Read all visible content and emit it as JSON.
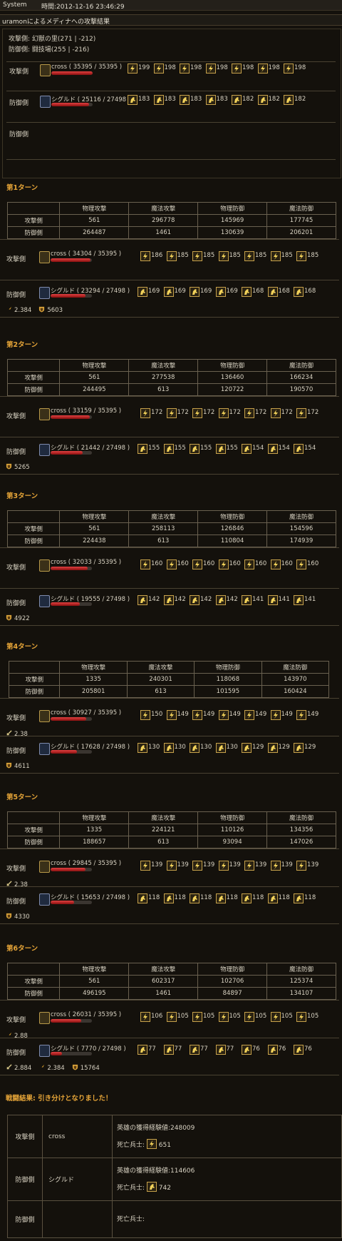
{
  "topbar": {
    "system": "System",
    "time": "時間:2012-12-16 23:46:29"
  },
  "title": "uramonによるメディナへの攻撃結果",
  "summary": {
    "attacker_line": "攻撃側: 幻獣の里(271 | -212)",
    "defender_line": "防御側: 闘技場(255 | -216)",
    "rows": [
      {
        "label": "攻撃側",
        "name": "cross ( 35395 / 35395 )",
        "hp": 1.0,
        "icon": "attacker-unit-icon",
        "sicon": "lightning-icon",
        "nums": [
          "199",
          "198",
          "198",
          "198",
          "198",
          "198",
          "198"
        ]
      },
      {
        "label": "防御側",
        "name": "シグルド ( 25116 / 27498 )",
        "hp": 0.91,
        "icon": "defender-unit-icon",
        "sicon": "horse-icon",
        "nums": [
          "183",
          "183",
          "183",
          "183",
          "182",
          "182",
          "182"
        ]
      },
      {
        "label": "防御側",
        "name": "",
        "hp": null,
        "icon": null,
        "sicon": null,
        "nums": []
      }
    ]
  },
  "stat_headers": [
    "",
    "物理攻撃",
    "魔法攻撃",
    "物理防御",
    "魔法防御"
  ],
  "turns": [
    {
      "title": "第1ターン",
      "att_row": [
        "攻撃側",
        "561",
        "296778",
        "145969",
        "177745"
      ],
      "def_row": [
        "防御側",
        "264487",
        "1461",
        "130639",
        "206201"
      ],
      "att": {
        "label": "攻撃側",
        "name": "cross ( 34304 / 35395 )",
        "hp": 0.97,
        "nums": [
          "186",
          "185",
          "185",
          "185",
          "185",
          "185",
          "185"
        ],
        "status": []
      },
      "def": {
        "label": "防御側",
        "name": "シグルド ( 23294 / 27498 )",
        "hp": 0.85,
        "nums": [
          "169",
          "169",
          "169",
          "169",
          "168",
          "168",
          "168"
        ],
        "status": [
          {
            "icon": "bolt",
            "text": "2.384"
          },
          {
            "icon": "shield",
            "text": "5603"
          }
        ]
      }
    },
    {
      "title": "第2ターン",
      "att_row": [
        "攻撃側",
        "561",
        "277538",
        "136460",
        "166234"
      ],
      "def_row": [
        "防御側",
        "244495",
        "613",
        "120722",
        "190570"
      ],
      "att": {
        "label": "攻撃側",
        "name": "cross ( 33159 / 35395 )",
        "hp": 0.94,
        "nums": [
          "172",
          "172",
          "172",
          "172",
          "172",
          "172",
          "172"
        ],
        "status": []
      },
      "def": {
        "label": "防御側",
        "name": "シグルド ( 21442 / 27498 )",
        "hp": 0.78,
        "nums": [
          "155",
          "155",
          "155",
          "155",
          "154",
          "154",
          "154"
        ],
        "status": [
          {
            "icon": "shield",
            "text": "5265"
          }
        ]
      }
    },
    {
      "title": "第3ターン",
      "att_row": [
        "攻撃側",
        "561",
        "258113",
        "126846",
        "154596"
      ],
      "def_row": [
        "防御側",
        "224438",
        "613",
        "110804",
        "174939"
      ],
      "att": {
        "label": "攻撃側",
        "name": "cross ( 32033 / 35395 )",
        "hp": 0.9,
        "nums": [
          "160",
          "160",
          "160",
          "160",
          "160",
          "160",
          "160"
        ],
        "status": []
      },
      "def": {
        "label": "防御側",
        "name": "シグルド ( 19555 / 27498 )",
        "hp": 0.71,
        "nums": [
          "142",
          "142",
          "142",
          "142",
          "141",
          "141",
          "141"
        ],
        "status": [
          {
            "icon": "shield",
            "text": "4922"
          }
        ]
      }
    },
    {
      "title": "第4ターン",
      "att_row": [
        "攻撃側",
        "1335",
        "240301",
        "118068",
        "143970"
      ],
      "def_row": [
        "防御側",
        "205801",
        "613",
        "101595",
        "160424"
      ],
      "att": {
        "label": "攻撃側",
        "name": "cross ( 30927 / 35395 )",
        "hp": 0.87,
        "nums": [
          "150",
          "149",
          "149",
          "149",
          "149",
          "149",
          "149"
        ],
        "status": [
          {
            "icon": "sword",
            "text": "2.38"
          }
        ]
      },
      "def": {
        "label": "防御側",
        "name": "シグルド ( 17628 / 27498 )",
        "hp": 0.64,
        "nums": [
          "130",
          "130",
          "130",
          "130",
          "129",
          "129",
          "129"
        ],
        "status": [
          {
            "icon": "shield",
            "text": "4611"
          }
        ]
      }
    },
    {
      "title": "第5ターン",
      "att_row": [
        "攻撃側",
        "1335",
        "224121",
        "110126",
        "134356"
      ],
      "def_row": [
        "防御側",
        "188657",
        "613",
        "93094",
        "147026"
      ],
      "att": {
        "label": "攻撃側",
        "name": "cross ( 29845 / 35395 )",
        "hp": 0.84,
        "nums": [
          "139",
          "139",
          "139",
          "139",
          "139",
          "139",
          "139"
        ],
        "status": [
          {
            "icon": "sword",
            "text": "2.38"
          }
        ]
      },
      "def": {
        "label": "防御側",
        "name": "シグルド ( 15653 / 27498 )",
        "hp": 0.57,
        "nums": [
          "118",
          "118",
          "118",
          "118",
          "118",
          "118",
          "118"
        ],
        "status": [
          {
            "icon": "shield",
            "text": "4330"
          }
        ]
      }
    },
    {
      "title": "第6ターン",
      "att_row": [
        "攻撃側",
        "561",
        "602317",
        "102706",
        "125374"
      ],
      "def_row": [
        "防御側",
        "496195",
        "1461",
        "84897",
        "134107"
      ],
      "att": {
        "label": "攻撃側",
        "name": "cross ( 26031 / 35395 )",
        "hp": 0.74,
        "nums": [
          "106",
          "105",
          "105",
          "105",
          "105",
          "105",
          "105"
        ],
        "status": [
          {
            "icon": "bolt",
            "text": "2.88"
          }
        ]
      },
      "def": {
        "label": "防御側",
        "name": "シグルド ( 7770 / 27498 )",
        "hp": 0.28,
        "nums": [
          "77",
          "77",
          "77",
          "77",
          "76",
          "76",
          "76"
        ],
        "status": [
          {
            "icon": "sword",
            "text": "2.884"
          },
          {
            "icon": "bolt",
            "text": "2.384"
          },
          {
            "icon": "shield",
            "text": "15764"
          }
        ]
      }
    }
  ],
  "result": {
    "title": "戦闘結果: 引き分けとなりました！",
    "rows": [
      {
        "side": "攻撃側",
        "name": "cross",
        "exp": "英雄の獲得経験値:248009",
        "dead_label": "死亡兵士:",
        "dead_icon": "lightning-icon",
        "dead_num": "651"
      },
      {
        "side": "防御側",
        "name": "シグルド",
        "exp": "英雄の獲得経験値:114606",
        "dead_label": "死亡兵士:",
        "dead_icon": "horse-icon",
        "dead_num": "742"
      },
      {
        "side": "防御側",
        "name": "",
        "exp": "",
        "dead_label": "死亡兵士:",
        "dead_icon": null,
        "dead_num": ""
      }
    ]
  },
  "colors": {
    "bg": "#14110c",
    "accent": "#e6a538",
    "hp": "#d02020",
    "grid": "#6a6150"
  }
}
